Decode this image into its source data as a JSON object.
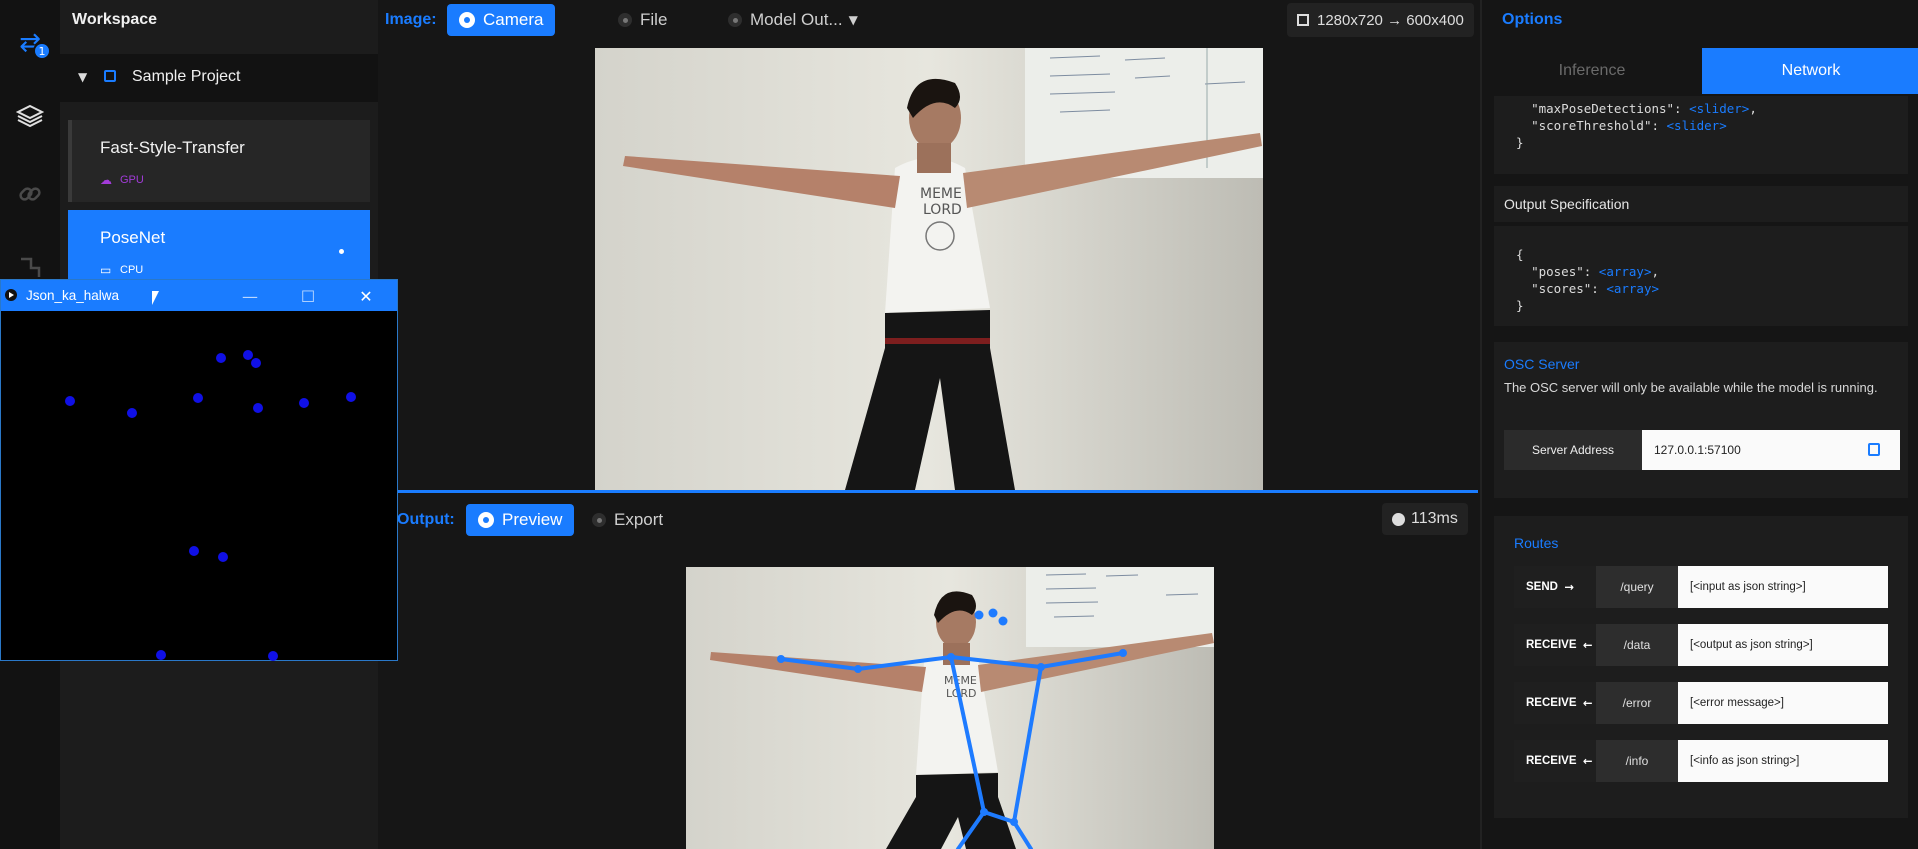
{
  "rail": {
    "badge_count": "1"
  },
  "workspace": {
    "title": "Workspace",
    "project_name": "Sample Project",
    "models": [
      {
        "name": "Fast-Style-Transfer",
        "hardware": "GPU",
        "hardware_color": "#a23bd9",
        "active": false
      },
      {
        "name": "PoseNet",
        "hardware": "CPU",
        "active": true
      }
    ]
  },
  "image_toolbar": {
    "label": "Image:",
    "camera": "Camera",
    "file": "File",
    "model_output": "Model Out...",
    "resolution": "1280x720 → 600x400"
  },
  "output_toolbar": {
    "label": "Output:",
    "preview": "Preview",
    "export": "Export",
    "latency": "113ms"
  },
  "options": {
    "title": "Options",
    "tabs": [
      "Inference",
      "Network"
    ],
    "active_tab": "Network",
    "input_spec_tail": {
      "line1_key": "\"maxPoseDetections\": ",
      "line1_type": "<slider>",
      "line1_end": ",",
      "line2_key": "\"scoreThreshold\": ",
      "line2_type": "<slider>",
      "close": "}"
    },
    "output_spec": {
      "header": "Output Specification",
      "open": "{",
      "line1_key": "\"poses\": ",
      "line1_type": "<array>",
      "line1_end": ",",
      "line2_key": "\"scores\": ",
      "line2_type": "<array>",
      "close": "}"
    },
    "osc": {
      "title": "OSC Server",
      "description": "The OSC server will only be available while the model is running.",
      "address_label": "Server Address",
      "address_value": "127.0.0.1:57100"
    },
    "routes": {
      "title": "Routes",
      "items": [
        {
          "dir": "SEND",
          "arrow": "→",
          "path": "/query",
          "value": "[<input as json string>]"
        },
        {
          "dir": "RECEIVE",
          "arrow": "←",
          "path": "/data",
          "value": "[<output as json string>]"
        },
        {
          "dir": "RECEIVE",
          "arrow": "←",
          "path": "/error",
          "value": "[<error message>]"
        },
        {
          "dir": "RECEIVE",
          "arrow": "←",
          "path": "/info",
          "value": "[<info as json string>]"
        }
      ]
    }
  },
  "float_window": {
    "title": "Json_ka_halwa",
    "minimize": "—",
    "maximize": "☐",
    "close": "✕"
  },
  "colors": {
    "accent": "#1a7cff",
    "keypoint": "#1010e6",
    "skeleton": "#1e7bff"
  }
}
